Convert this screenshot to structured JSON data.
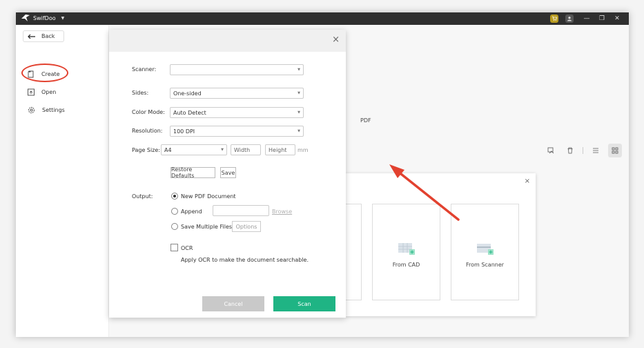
{
  "titlebar": {
    "app_name": "SwifDoo",
    "minimize": "—",
    "maximize": "❐",
    "close": "✕"
  },
  "sidebar": {
    "back_label": "Back",
    "items": [
      {
        "label": "Create",
        "icon": "create-icon"
      },
      {
        "label": "Open",
        "icon": "open-icon"
      },
      {
        "label": "Settings",
        "icon": "gear-icon"
      }
    ]
  },
  "main": {
    "pdf_label": "PDF",
    "create_panel": {
      "close": "×",
      "cards": [
        {
          "label": "From CAD",
          "icon": "cad-icon"
        },
        {
          "label": "From Scanner",
          "icon": "scanner-icon"
        }
      ]
    }
  },
  "dialog": {
    "close": "×",
    "scanner_label": "Scanner:",
    "scanner_value": "",
    "sides_label": "Sides:",
    "sides_value": "One-sided",
    "color_mode_label": "Color Mode:",
    "color_mode_value": "Auto Detect",
    "resolution_label": "Resolution:",
    "resolution_value": "100 DPI",
    "page_size_label": "Page Size:",
    "page_size_value": "A4",
    "width_placeholder": "Width",
    "height_placeholder": "Height",
    "unit": "mm",
    "restore_defaults": "Restore Defaults",
    "save": "Save",
    "output_label": "Output:",
    "output_options": {
      "new_pdf": "New PDF Document",
      "append": "Append",
      "browse": "Browse",
      "save_multiple": "Save Multiple Files",
      "options": "Options"
    },
    "ocr_label": "OCR",
    "ocr_desc": "Apply OCR to make the document searchable.",
    "cancel": "Cancel",
    "scan": "Scan"
  },
  "colors": {
    "accent": "#1fb484",
    "annotation": "#e2412f",
    "titlebar": "#2f2f2f"
  }
}
